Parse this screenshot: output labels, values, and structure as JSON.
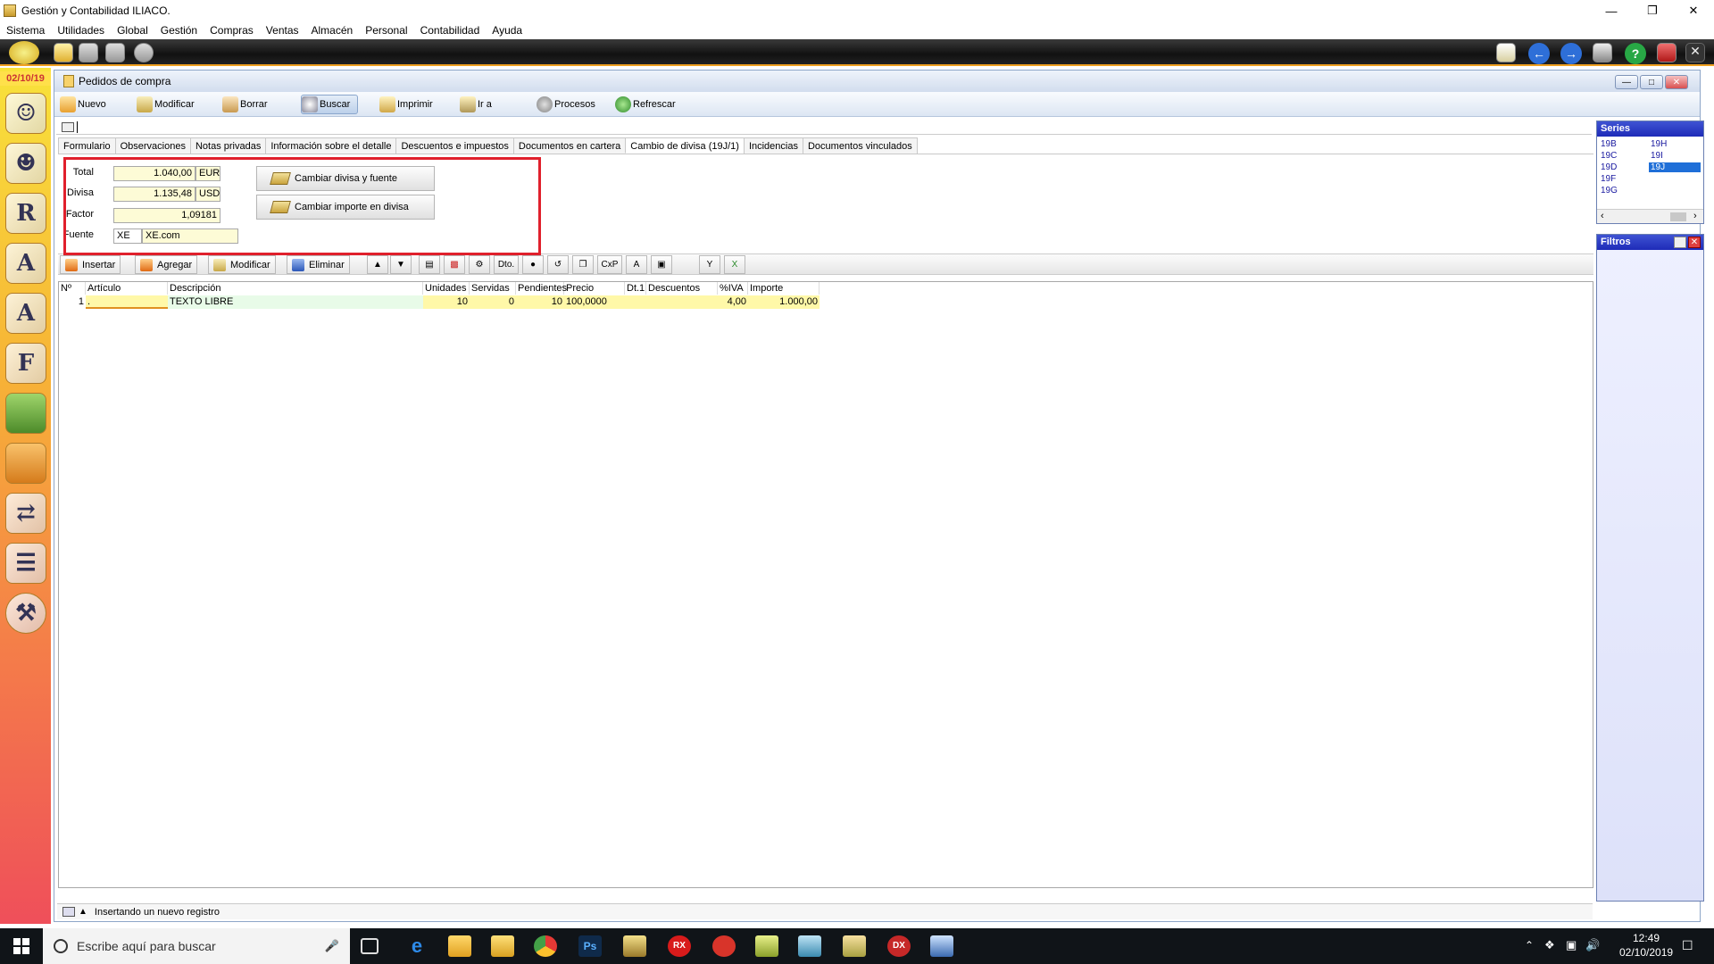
{
  "app": {
    "title": "Gestión y Contabilidad ILIACO."
  },
  "menu": [
    "Sistema",
    "Utilidades",
    "Global",
    "Gestión",
    "Compras",
    "Ventas",
    "Almacén",
    "Personal",
    "Contabilidad",
    "Ayuda"
  ],
  "sidebar": {
    "date": "02/10/19",
    "icons": [
      "users-icon",
      "user-icon",
      "user-r-icon",
      "user-a-icon",
      "letter-a-icon",
      "letter-f-icon",
      "bag-icon",
      "briefcase-icon",
      "transfer-icon",
      "ledger-icon",
      "tools-icon"
    ]
  },
  "window": {
    "title": "Pedidos de compra",
    "toolbar": [
      "Nuevo",
      "Modificar",
      "Borrar",
      "Buscar",
      "Imprimir",
      "Ir a",
      "Procesos",
      "Refrescar"
    ]
  },
  "tabs": [
    "Formulario",
    "Observaciones",
    "Notas privadas",
    "Información sobre el detalle",
    "Descuentos e impuestos",
    "Documentos en cartera",
    "Cambio de divisa (19J/1)",
    "Incidencias",
    "Documentos vinculados"
  ],
  "currency": {
    "total_label": "Total",
    "total_value": "1.040,00",
    "total_currency": "EUR",
    "divisa_label": "Divisa",
    "divisa_value": "1.135,48",
    "divisa_currency": "USD",
    "factor_label": "Factor",
    "factor_value": "1,09181",
    "fuente_label": "Fuente",
    "fuente_code": "XE",
    "fuente_name": "XE.com",
    "btn_cambiar_divisa": "Cambiar divisa y fuente",
    "btn_cambiar_importe": "Cambiar importe en divisa"
  },
  "line_toolbar": {
    "insertar": "Insertar",
    "agregar": "Agregar",
    "modificar": "Modificar",
    "eliminar": "Eliminar",
    "dto": "Dto.",
    "cxp": "CxP"
  },
  "grid": {
    "headers": [
      "Nº",
      "Artículo",
      "Descripción",
      "Unidades",
      "Servidas",
      "Pendientes",
      "Precio",
      "Dt.1",
      "Descuentos",
      "%IVA",
      "Importe"
    ],
    "rows": [
      {
        "n": "1",
        "articulo": ".",
        "descripcion": "TEXTO LIBRE",
        "unidades": "10",
        "servidas": "0",
        "pendientes": "10",
        "precio": "100,0000",
        "dt1": "",
        "descuentos": "",
        "iva": "4,00",
        "importe": "1.000,00"
      }
    ]
  },
  "series": {
    "title": "Series",
    "col1": [
      "19B",
      "19C",
      "19D",
      "19F",
      "19G"
    ],
    "col2": [
      "19H",
      "19I",
      "19J"
    ],
    "selected": "19J"
  },
  "filtros": {
    "title": "Filtros"
  },
  "status": {
    "text": "Insertando un nuevo registro"
  },
  "taskbar": {
    "search_placeholder": "Escribe aquí para buscar",
    "time": "12:49",
    "date": "02/10/2019"
  }
}
